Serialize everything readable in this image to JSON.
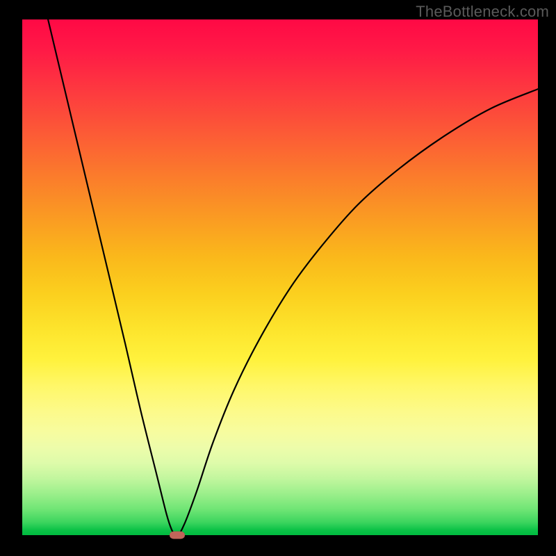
{
  "watermark": "TheBottleneck.com",
  "chart_data": {
    "type": "line",
    "title": "",
    "xlabel": "",
    "ylabel": "",
    "xlim": [
      0,
      100
    ],
    "ylim": [
      0,
      100
    ],
    "grid": false,
    "legend": false,
    "series": [
      {
        "name": "bottleneck-curve",
        "x": [
          5,
          10,
          15,
          20,
          23,
          26,
          28,
          29,
          29.6,
          30,
          30.4,
          31,
          32,
          34,
          37,
          41,
          46,
          52,
          58,
          65,
          73,
          82,
          91,
          100
        ],
        "y": [
          100,
          79,
          58,
          37,
          24,
          12,
          4,
          1,
          0.2,
          0,
          0.2,
          1.2,
          3.5,
          9,
          18,
          28,
          38,
          48,
          56,
          64,
          71,
          77.5,
          82.8,
          86.5
        ]
      }
    ],
    "marker": {
      "x": 30,
      "y": 0
    },
    "gradient_stops": [
      {
        "pos": 0,
        "color": "#ff0945"
      },
      {
        "pos": 50,
        "color": "#fbcf1e"
      },
      {
        "pos": 75,
        "color": "#fff768"
      },
      {
        "pos": 100,
        "color": "#00bb40"
      }
    ]
  }
}
